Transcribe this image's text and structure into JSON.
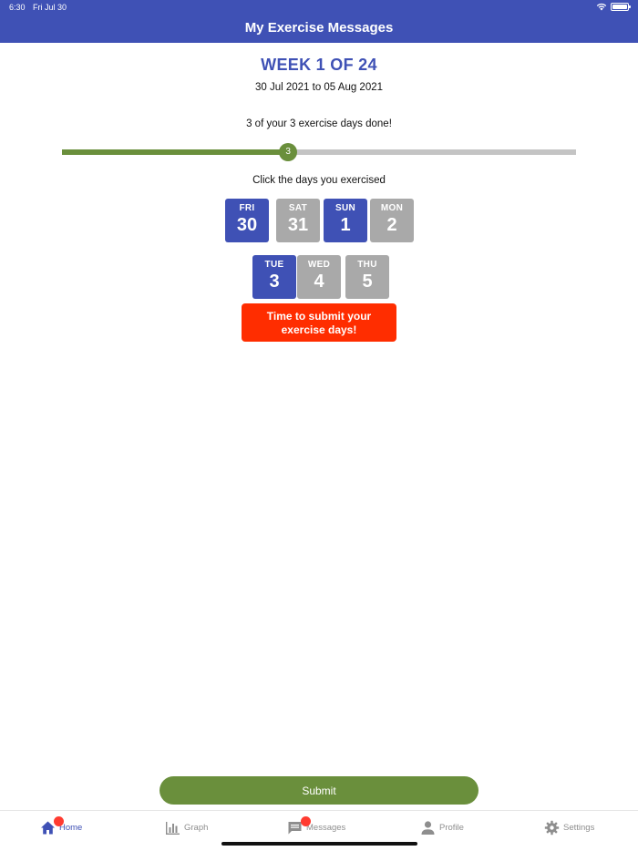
{
  "status_bar": {
    "time": "6:30",
    "date": "Fri Jul 30"
  },
  "header": {
    "title": "My Exercise Messages",
    "background_color": "#3f51b5"
  },
  "week": {
    "title": "WEEK 1 OF 24",
    "date_range": "30 Jul 2021 to 05 Aug 2021"
  },
  "progress": {
    "text": "3 of your 3 exercise days done!",
    "value": 3,
    "fraction": 0.44,
    "fill_color": "#6a8f3c",
    "track_color": "#c4c4c4"
  },
  "days_prompt": "Click the days you exercised",
  "days": [
    {
      "name": "FRI",
      "number": "30",
      "selected": true
    },
    {
      "name": "SAT",
      "number": "31",
      "selected": false
    },
    {
      "name": "SUN",
      "number": "1",
      "selected": true
    },
    {
      "name": "MON",
      "number": "2",
      "selected": false
    },
    {
      "name": "TUE",
      "number": "3",
      "selected": true
    },
    {
      "name": "WED",
      "number": "4",
      "selected": false
    },
    {
      "name": "THU",
      "number": "5",
      "selected": false
    }
  ],
  "colors": {
    "selected_day": "#3f51b5",
    "unselected_day": "#a9a9a9",
    "reminder": "#ff2d00",
    "submit": "#6a8f3c"
  },
  "reminder": {
    "line1": "Time to submit your",
    "line2": "exercise days!"
  },
  "submit_label": "Submit",
  "tabs": [
    {
      "label": "Home",
      "icon": "home-icon",
      "active": true,
      "badge": true
    },
    {
      "label": "Graph",
      "icon": "bar-chart-icon",
      "active": false,
      "badge": false
    },
    {
      "label": "Messages",
      "icon": "message-icon",
      "active": false,
      "badge": true
    },
    {
      "label": "Profile",
      "icon": "person-icon",
      "active": false,
      "badge": false
    },
    {
      "label": "Settings",
      "icon": "gear-icon",
      "active": false,
      "badge": false
    }
  ]
}
